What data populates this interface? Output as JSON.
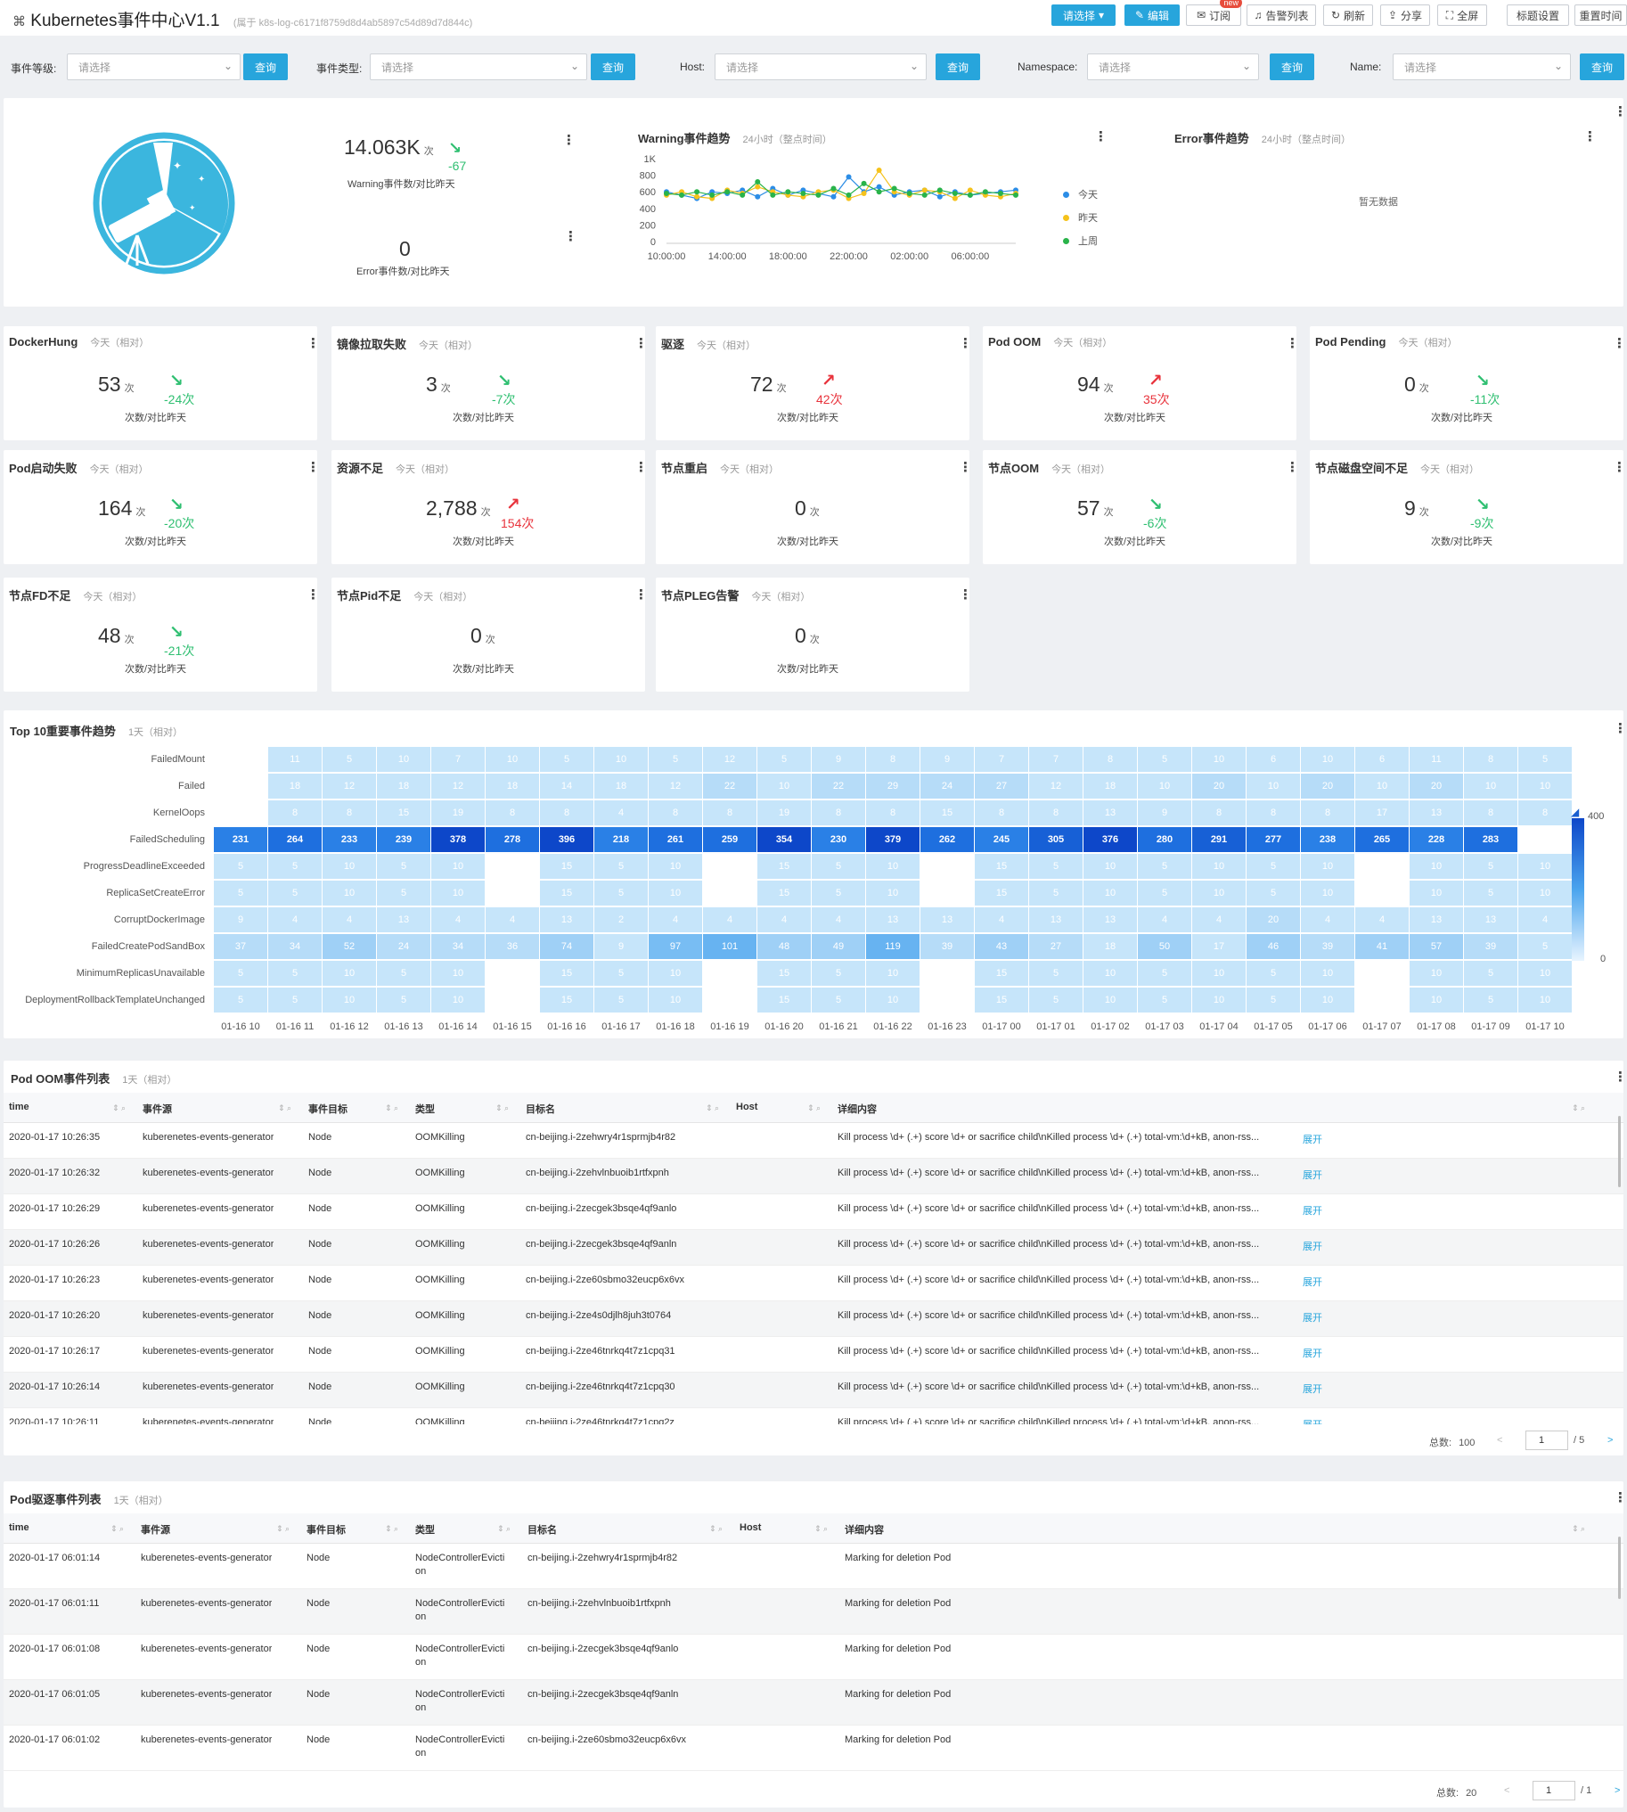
{
  "header": {
    "app_icon": "tag-icon",
    "title": "Kubernetes事件中心V1.1",
    "subtitle": "(属于 k8s-log-c6171f8759d8d4ab5897c54d89d7d844c)",
    "buttons": {
      "select": "请选择",
      "edit": "编辑",
      "subscribe": "订阅",
      "new_tag": "new",
      "alerts": "告警列表",
      "refresh": "刷新",
      "share": "分享",
      "fullscreen": "全屏",
      "title_settings": "标题设置",
      "reset_time": "重置时间"
    }
  },
  "filters": [
    {
      "label": "事件等级:",
      "placeholder": "请选择",
      "button": "查询"
    },
    {
      "label": "事件类型:",
      "placeholder": "请选择",
      "button": "查询"
    },
    {
      "label": "Host:",
      "placeholder": "请选择",
      "button": "查询"
    },
    {
      "label": "Namespace:",
      "placeholder": "请选择",
      "button": "查询"
    },
    {
      "label": "Name:",
      "placeholder": "请选择",
      "button": "查询"
    }
  ],
  "overview": {
    "warning_value": "14.063K",
    "warning_unit": "次",
    "warning_delta": "-67",
    "warning_caption": "Warning事件数/对比昨天",
    "error_value": "0",
    "error_caption": "Error事件数/对比昨天"
  },
  "warning_trend": {
    "title": "Warning事件趋势",
    "subtitle": "24小时（整点时间）",
    "legend": [
      {
        "name": "今天",
        "color": "#2c8de6"
      },
      {
        "name": "昨天",
        "color": "#f5c21b"
      },
      {
        "name": "上周",
        "color": "#29b34a"
      }
    ],
    "y_ticks": [
      "1K",
      "800",
      "600",
      "400",
      "200",
      "0"
    ],
    "x_ticks": [
      "10:00:00",
      "14:00:00",
      "18:00:00",
      "22:00:00",
      "02:00:00",
      "06:00:00"
    ]
  },
  "chart_data": {
    "type": "line",
    "title": "Warning事件趋势",
    "ylim": [
      0,
      1000
    ],
    "x": [
      "10:00:00",
      "11:00:00",
      "12:00:00",
      "13:00:00",
      "14:00:00",
      "15:00:00",
      "16:00:00",
      "17:00:00",
      "18:00:00",
      "19:00:00",
      "20:00:00",
      "21:00:00",
      "22:00:00",
      "23:00:00",
      "00:00:00",
      "01:00:00",
      "02:00:00",
      "03:00:00",
      "04:00:00",
      "05:00:00",
      "06:00:00",
      "07:00:00",
      "08:00:00",
      "09:00:00"
    ],
    "series": [
      {
        "name": "今天",
        "values": [
          600,
          560,
          520,
          600,
          580,
          620,
          540,
          640,
          560,
          620,
          580,
          540,
          780,
          600,
          660,
          560,
          600,
          620,
          540,
          600,
          560,
          580,
          600,
          620
        ]
      },
      {
        "name": "昨天",
        "values": [
          560,
          600,
          540,
          520,
          620,
          580,
          660,
          600,
          560,
          540,
          600,
          620,
          520,
          580,
          860,
          600,
          560,
          620,
          600,
          520,
          620,
          560,
          540,
          580
        ]
      },
      {
        "name": "上周",
        "values": [
          580,
          560,
          600,
          560,
          600,
          560,
          720,
          560,
          600,
          580,
          560,
          640,
          560,
          700,
          600,
          640,
          580,
          560,
          620,
          580,
          560,
          600,
          580,
          560
        ]
      }
    ]
  },
  "error_trend": {
    "title": "Error事件趋势",
    "subtitle": "24小时（整点时间）",
    "empty": "暂无数据"
  },
  "kpis": [
    {
      "title": "DockerHung",
      "sub": "今天（相对）",
      "value": "53",
      "unit": "次",
      "delta": "-24次",
      "dir": "down",
      "caption": "次数/对比昨天"
    },
    {
      "title": "镜像拉取失败",
      "sub": "今天（相对）",
      "value": "3",
      "unit": "次",
      "delta": "-7次",
      "dir": "down",
      "caption": "次数/对比昨天"
    },
    {
      "title": "驱逐",
      "sub": "今天（相对）",
      "value": "72",
      "unit": "次",
      "delta": "42次",
      "dir": "up",
      "caption": "次数/对比昨天"
    },
    {
      "title": "Pod OOM",
      "sub": "今天（相对）",
      "value": "94",
      "unit": "次",
      "delta": "35次",
      "dir": "up",
      "caption": "次数/对比昨天"
    },
    {
      "title": "Pod Pending",
      "sub": "今天（相对）",
      "value": "0",
      "unit": "次",
      "delta": "-11次",
      "dir": "down",
      "caption": "次数/对比昨天"
    },
    {
      "title": "Pod启动失败",
      "sub": "今天（相对）",
      "value": "164",
      "unit": "次",
      "delta": "-20次",
      "dir": "down",
      "caption": "次数/对比昨天"
    },
    {
      "title": "资源不足",
      "sub": "今天（相对）",
      "value": "2,788",
      "unit": "次",
      "delta": "154次",
      "dir": "up",
      "caption": "次数/对比昨天"
    },
    {
      "title": "节点重启",
      "sub": "今天（相对）",
      "value": "0",
      "unit": "次",
      "delta": "",
      "dir": "none",
      "caption": "次数/对比昨天"
    },
    {
      "title": "节点OOM",
      "sub": "今天（相对）",
      "value": "57",
      "unit": "次",
      "delta": "-6次",
      "dir": "down",
      "caption": "次数/对比昨天"
    },
    {
      "title": "节点磁盘空间不足",
      "sub": "今天（相对）",
      "value": "9",
      "unit": "次",
      "delta": "-9次",
      "dir": "down",
      "caption": "次数/对比昨天"
    },
    {
      "title": "节点FD不足",
      "sub": "今天（相对）",
      "value": "48",
      "unit": "次",
      "delta": "-21次",
      "dir": "down",
      "caption": "次数/对比昨天"
    },
    {
      "title": "节点Pid不足",
      "sub": "今天（相对）",
      "value": "0",
      "unit": "次",
      "delta": "",
      "dir": "none",
      "caption": "次数/对比昨天"
    },
    {
      "title": "节点PLEG告警",
      "sub": "今天（相对）",
      "value": "0",
      "unit": "次",
      "delta": "",
      "dir": "none",
      "caption": "次数/对比昨天"
    }
  ],
  "heatmap": {
    "title": "Top 10重要事件趋势",
    "subtitle": "1天（相对）",
    "legend_max": "400",
    "legend_min": "0",
    "rows": [
      "FailedMount",
      "Failed",
      "KernelOops",
      "FailedScheduling",
      "ProgressDeadlineExceeded",
      "ReplicaSetCreateError",
      "CorruptDockerImage",
      "FailedCreatePodSandBox",
      "MinimumReplicasUnavailable",
      "DeploymentRollbackTemplateUnchanged"
    ],
    "cols": [
      "01-16 10",
      "01-16 11",
      "01-16 12",
      "01-16 13",
      "01-16 14",
      "01-16 15",
      "01-16 16",
      "01-16 17",
      "01-16 18",
      "01-16 19",
      "01-16 20",
      "01-16 21",
      "01-16 22",
      "01-16 23",
      "01-17 00",
      "01-17 01",
      "01-17 02",
      "01-17 03",
      "01-17 04",
      "01-17 05",
      "01-17 06",
      "01-17 07",
      "01-17 08",
      "01-17 09",
      "01-17 10"
    ],
    "values": [
      [
        null,
        11,
        5,
        10,
        7,
        10,
        5,
        10,
        5,
        12,
        5,
        9,
        8,
        9,
        7,
        7,
        8,
        5,
        10,
        6,
        10,
        6,
        11,
        8,
        5
      ],
      [
        null,
        18,
        12,
        18,
        12,
        18,
        14,
        18,
        12,
        22,
        10,
        22,
        29,
        24,
        27,
        12,
        18,
        10,
        20,
        10,
        20,
        10,
        20,
        10,
        10
      ],
      [
        null,
        8,
        8,
        15,
        19,
        8,
        8,
        4,
        8,
        8,
        19,
        8,
        8,
        15,
        8,
        8,
        13,
        9,
        8,
        8,
        8,
        17,
        13,
        8,
        8
      ],
      [
        231,
        264,
        233,
        239,
        378,
        278,
        396,
        218,
        261,
        259,
        354,
        230,
        379,
        262,
        245,
        305,
        376,
        280,
        291,
        277,
        238,
        265,
        228,
        283,
        null
      ],
      [
        5,
        5,
        10,
        5,
        10,
        null,
        15,
        5,
        10,
        null,
        15,
        5,
        10,
        null,
        15,
        5,
        10,
        5,
        10,
        5,
        10,
        null,
        10,
        5,
        10
      ],
      [
        5,
        5,
        10,
        5,
        10,
        null,
        15,
        5,
        10,
        null,
        15,
        5,
        10,
        null,
        15,
        5,
        10,
        5,
        10,
        5,
        10,
        null,
        10,
        5,
        10
      ],
      [
        9,
        4,
        4,
        13,
        4,
        4,
        13,
        2,
        4,
        4,
        4,
        4,
        13,
        13,
        4,
        13,
        13,
        4,
        4,
        20,
        4,
        4,
        13,
        13,
        4
      ],
      [
        37,
        34,
        52,
        24,
        34,
        36,
        74,
        9,
        97,
        101,
        48,
        49,
        119,
        39,
        43,
        27,
        18,
        50,
        17,
        46,
        39,
        41,
        57,
        39,
        5
      ],
      [
        5,
        5,
        10,
        5,
        10,
        null,
        15,
        5,
        10,
        null,
        15,
        5,
        10,
        null,
        15,
        5,
        10,
        5,
        10,
        5,
        10,
        null,
        10,
        5,
        10
      ],
      [
        5,
        5,
        10,
        5,
        10,
        null,
        15,
        5,
        10,
        null,
        15,
        5,
        10,
        null,
        15,
        5,
        10,
        5,
        10,
        5,
        10,
        null,
        10,
        5,
        10
      ]
    ]
  },
  "oom_table": {
    "title": "Pod OOM事件列表",
    "subtitle": "1天（相对）",
    "columns": [
      "time",
      "事件源",
      "事件目标",
      "类型",
      "目标名",
      "Host",
      "详细内容"
    ],
    "expand_label": "展开",
    "rows": [
      [
        "2020-01-17 10:26:35",
        "kuberenetes-events-generator",
        "Node",
        "OOMKilling",
        "cn-beijing.i-2zehwry4r1sprmjb4r82",
        "",
        "Kill process \\d+ (.+) score \\d+ or sacrifice child\\nKilled process \\d+ (.+) total-vm:\\d+kB, anon-rss..."
      ],
      [
        "2020-01-17 10:26:32",
        "kuberenetes-events-generator",
        "Node",
        "OOMKilling",
        "cn-beijing.i-2zehvlnbuoib1rtfxpnh",
        "",
        "Kill process \\d+ (.+) score \\d+ or sacrifice child\\nKilled process \\d+ (.+) total-vm:\\d+kB, anon-rss..."
      ],
      [
        "2020-01-17 10:26:29",
        "kuberenetes-events-generator",
        "Node",
        "OOMKilling",
        "cn-beijing.i-2zecgek3bsqe4qf9anlo",
        "",
        "Kill process \\d+ (.+) score \\d+ or sacrifice child\\nKilled process \\d+ (.+) total-vm:\\d+kB, anon-rss..."
      ],
      [
        "2020-01-17 10:26:26",
        "kuberenetes-events-generator",
        "Node",
        "OOMKilling",
        "cn-beijing.i-2zecgek3bsqe4qf9anln",
        "",
        "Kill process \\d+ (.+) score \\d+ or sacrifice child\\nKilled process \\d+ (.+) total-vm:\\d+kB, anon-rss..."
      ],
      [
        "2020-01-17 10:26:23",
        "kuberenetes-events-generator",
        "Node",
        "OOMKilling",
        "cn-beijing.i-2ze60sbmo32eucp6x6vx",
        "",
        "Kill process \\d+ (.+) score \\d+ or sacrifice child\\nKilled process \\d+ (.+) total-vm:\\d+kB, anon-rss..."
      ],
      [
        "2020-01-17 10:26:20",
        "kuberenetes-events-generator",
        "Node",
        "OOMKilling",
        "cn-beijing.i-2ze4s0djlh8juh3t0764",
        "",
        "Kill process \\d+ (.+) score \\d+ or sacrifice child\\nKilled process \\d+ (.+) total-vm:\\d+kB, anon-rss..."
      ],
      [
        "2020-01-17 10:26:17",
        "kuberenetes-events-generator",
        "Node",
        "OOMKilling",
        "cn-beijing.i-2ze46tnrkq4t7z1cpq31",
        "",
        "Kill process \\d+ (.+) score \\d+ or sacrifice child\\nKilled process \\d+ (.+) total-vm:\\d+kB, anon-rss..."
      ],
      [
        "2020-01-17 10:26:14",
        "kuberenetes-events-generator",
        "Node",
        "OOMKilling",
        "cn-beijing.i-2ze46tnrkq4t7z1cpq30",
        "",
        "Kill process \\d+ (.+) score \\d+ or sacrifice child\\nKilled process \\d+ (.+) total-vm:\\d+kB, anon-rss..."
      ],
      [
        "2020-01-17 10:26:11",
        "kuberenetes-events-generator",
        "Node",
        "OOMKilling",
        "cn-beijing.i-2ze46tnrkq4t7z1cpq2z",
        "",
        "Kill process \\d+ (.+) score \\d+ or sacrifice child\\nKilled process \\d+ (.+) total-vm:\\d+kB, anon-rss..."
      ]
    ],
    "pager": {
      "total_label": "总数:",
      "total": "100",
      "prev": "<",
      "page": "1",
      "pages": "/ 5",
      "next": ">"
    }
  },
  "evict_table": {
    "title": "Pod驱逐事件列表",
    "subtitle": "1天（相对）",
    "columns": [
      "time",
      "事件源",
      "事件目标",
      "类型",
      "目标名",
      "Host",
      "详细内容"
    ],
    "rows": [
      [
        "2020-01-17 06:01:14",
        "kuberenetes-events-generator",
        "Node",
        "NodeControllerEvicti",
        "on",
        "cn-beijing.i-2zehwry4r1sprmjb4r82",
        "",
        "Marking for deletion Pod"
      ],
      [
        "2020-01-17 06:01:11",
        "kuberenetes-events-generator",
        "Node",
        "NodeControllerEvicti",
        "on",
        "cn-beijing.i-2zehvlnbuoib1rtfxpnh",
        "",
        "Marking for deletion Pod"
      ],
      [
        "2020-01-17 06:01:08",
        "kuberenetes-events-generator",
        "Node",
        "NodeControllerEvicti",
        "on",
        "cn-beijing.i-2zecgek3bsqe4qf9anlo",
        "",
        "Marking for deletion Pod"
      ],
      [
        "2020-01-17 06:01:05",
        "kuberenetes-events-generator",
        "Node",
        "NodeControllerEvicti",
        "on",
        "cn-beijing.i-2zecgek3bsqe4qf9anln",
        "",
        "Marking for deletion Pod"
      ],
      [
        "2020-01-17 06:01:02",
        "kuberenetes-events-generator",
        "Node",
        "NodeControllerEvicti",
        "on",
        "cn-beijing.i-2ze60sbmo32eucp6x6vx",
        "",
        "Marking for deletion Pod"
      ]
    ],
    "pager": {
      "total_label": "总数:",
      "total": "20",
      "prev": "<",
      "page": "1",
      "pages": "/ 1",
      "next": ">"
    }
  }
}
